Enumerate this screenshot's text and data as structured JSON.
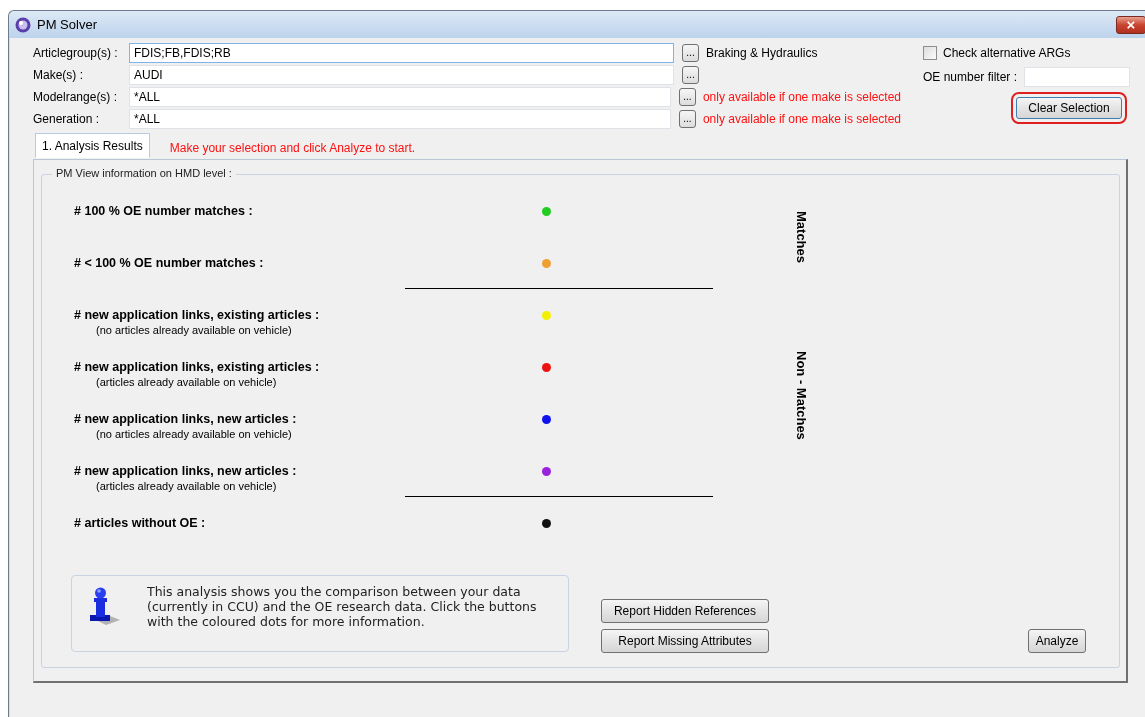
{
  "window": {
    "title": "PM Solver",
    "close": "×"
  },
  "fields": [
    {
      "label": "Articlegroup(s) :",
      "value": "FDIS;FB,FDIS;RB",
      "browse": "...",
      "note": "Braking & Hydraulics",
      "kind": "info",
      "focused": true
    },
    {
      "label": "Make(s) :",
      "value": "AUDI",
      "browse": "...",
      "focused": false
    },
    {
      "label": "Modelrange(s) :",
      "value": "*ALL",
      "browse": "...",
      "note": "only available if one make is selected",
      "kind": "warning",
      "focused": false
    },
    {
      "label": "Generation :",
      "value": "*ALL",
      "browse": "...",
      "note": "only available if one make is selected",
      "kind": "warning",
      "focused": false
    }
  ],
  "check_alternative": {
    "label": "Check alternative ARGs",
    "checked": false
  },
  "oe_filter": {
    "label": "OE number filter :"
  },
  "clear_button": {
    "label": "Clear Selection",
    "highlighted": true
  },
  "tabs": [
    {
      "label": "1. Analysis Results",
      "selected": true
    }
  ],
  "status_message": "Make your selection and click Analyze to start.",
  "group": {
    "legend": "PM View information on HMD level :",
    "rows": [
      {
        "kind": "result",
        "label": "# 100 % OE number matches :",
        "color": "#22cc22"
      },
      {
        "kind": "result",
        "label": "# < 100 % OE number matches :",
        "color": "#f0a030"
      },
      {
        "kind": "divider"
      },
      {
        "kind": "result",
        "label": "# new application links, existing articles :",
        "sublabel": "(no articles already available on vehicle)",
        "color": "#f0f000"
      },
      {
        "kind": "result",
        "label": "# new application links, existing articles :",
        "sublabel": "(articles already available on vehicle)",
        "color": "#ee1111"
      },
      {
        "kind": "result",
        "label": "# new application links, new articles :",
        "sublabel": "(no articles already available on vehicle)",
        "color": "#1111ee"
      },
      {
        "kind": "result",
        "label": "# new application links, new articles :",
        "sublabel": "(articles already available on vehicle)",
        "color": "#9922dd"
      },
      {
        "kind": "divider"
      },
      {
        "kind": "result",
        "label": "# articles without OE :",
        "color": "#111111"
      }
    ],
    "side_labels": [
      "Matches",
      "Non - Matches"
    ]
  },
  "info": {
    "text": "This analysis shows you the comparison between your data (currently in CCU) and the OE research data. Click the buttons with the coloured dots for more information."
  },
  "report_buttons": [
    {
      "label": "Report Hidden References"
    },
    {
      "label": "Report Missing Attributes"
    }
  ],
  "analyze_button": {
    "label": "Analyze"
  }
}
